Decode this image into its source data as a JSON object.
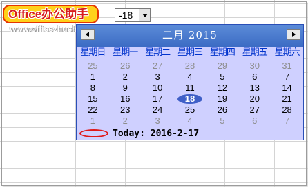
{
  "watermark": {
    "title": "Office办公助手",
    "url": "www.officezhushou.com"
  },
  "cell_combo": {
    "value": "-18"
  },
  "calendar": {
    "month_title": "二月 2015",
    "weekdays": [
      "星期日",
      "星期一",
      "星期二",
      "星期三",
      "星期四",
      "星期五",
      "星期六"
    ],
    "days": [
      {
        "text": "25",
        "muted": true
      },
      {
        "text": "26",
        "muted": true
      },
      {
        "text": "27",
        "muted": true
      },
      {
        "text": "28",
        "muted": true
      },
      {
        "text": "29",
        "muted": true
      },
      {
        "text": "30",
        "muted": true
      },
      {
        "text": "31",
        "muted": true
      },
      {
        "text": "1"
      },
      {
        "text": "2"
      },
      {
        "text": "3"
      },
      {
        "text": "4"
      },
      {
        "text": "5"
      },
      {
        "text": "6"
      },
      {
        "text": "7"
      },
      {
        "text": "8"
      },
      {
        "text": "9"
      },
      {
        "text": "10"
      },
      {
        "text": "11"
      },
      {
        "text": "12"
      },
      {
        "text": "13"
      },
      {
        "text": "14"
      },
      {
        "text": "15"
      },
      {
        "text": "16"
      },
      {
        "text": "17"
      },
      {
        "text": "18",
        "selected": true
      },
      {
        "text": "19"
      },
      {
        "text": "20"
      },
      {
        "text": "21"
      },
      {
        "text": "22"
      },
      {
        "text": "23"
      },
      {
        "text": "24"
      },
      {
        "text": "25"
      },
      {
        "text": "26"
      },
      {
        "text": "27"
      },
      {
        "text": "28"
      },
      {
        "text": "1",
        "muted": true
      },
      {
        "text": "2",
        "muted": true
      },
      {
        "text": "3",
        "muted": true
      },
      {
        "text": "4",
        "muted": true
      },
      {
        "text": "5",
        "muted": true
      },
      {
        "text": "6",
        "muted": true
      },
      {
        "text": "7",
        "muted": true
      }
    ],
    "today_label": "Today: 2016-2-17"
  },
  "colors": {
    "header": "#4a7bd0",
    "body": "#cfd0ff",
    "weekday_text": "#0033cc",
    "selected_fill": "#3f5fc7",
    "annotation_red": "#e01818"
  },
  "icons": [
    "prev-month-icon",
    "next-month-icon",
    "dropdown-arrow-icon"
  ]
}
